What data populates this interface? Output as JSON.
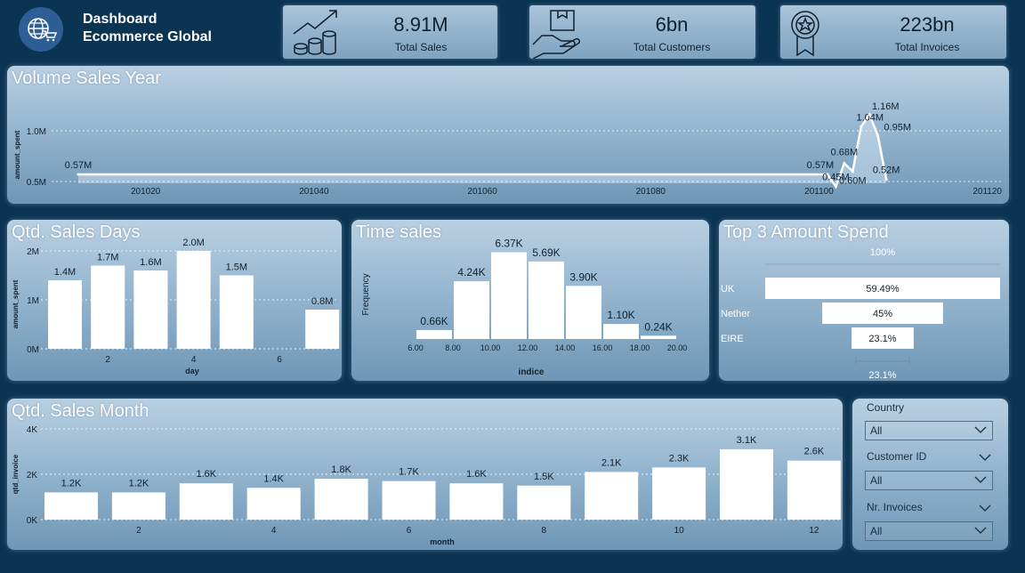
{
  "header": {
    "title_line1": "Dashboard",
    "title_line2": "Ecommerce Global",
    "logo_icon": "globe-cart-icon"
  },
  "kpis": [
    {
      "value": "8.91M",
      "label": "Total Sales",
      "icon": "coins-growth-icon"
    },
    {
      "value": "6bn",
      "label": "Total Customers",
      "icon": "hand-box-icon"
    },
    {
      "value": "223bn",
      "label": "Total Invoices",
      "icon": "award-badge-icon"
    }
  ],
  "colors": {
    "background": "#0b3352",
    "bar": "#ffffff",
    "panel_top": "#b9d0e3",
    "panel_bottom": "#6f97b5"
  },
  "volume_year": {
    "title": "Volume Sales Year",
    "chart_data": {
      "type": "area",
      "ylabel": "amount_spent",
      "y_ticks": [
        "0.5M",
        "1.0M"
      ],
      "x_ticks": [
        "201020",
        "201040",
        "201060",
        "201080",
        "201100",
        "201120"
      ],
      "points": [
        {
          "x": 201012,
          "y": 0.57,
          "label": "0.57M"
        },
        {
          "x": 201101,
          "y": 0.57,
          "label": "0.57M"
        },
        {
          "x": 201102,
          "y": 0.45,
          "label": "0.45M"
        },
        {
          "x": 201103,
          "y": 0.68,
          "label": "0.68M"
        },
        {
          "x": 201104,
          "y": 0.6,
          "label": "0.60M"
        },
        {
          "x": 201105,
          "y": 1.04,
          "label": "1.04M"
        },
        {
          "x": 201106,
          "y": 1.16,
          "label": "1.16M"
        },
        {
          "x": 201107,
          "y": 0.95,
          "label": "0.95M"
        },
        {
          "x": 201108,
          "y": 0.52,
          "label": "0.52M"
        }
      ]
    }
  },
  "sales_days": {
    "title": "Qtd. Sales Days",
    "chart_data": {
      "type": "bar",
      "xlabel": "day",
      "ylabel": "amount_spent",
      "y_ticks": [
        "0M",
        "1M",
        "2M"
      ],
      "x_ticks": [
        "2",
        "4",
        "6"
      ],
      "categories": [
        1,
        2,
        3,
        4,
        5,
        7
      ],
      "values": [
        1.4,
        1.7,
        1.6,
        2.0,
        1.5,
        0.8
      ],
      "labels": [
        "1.4M",
        "1.7M",
        "1.6M",
        "2.0M",
        "1.5M",
        "0.8M"
      ]
    }
  },
  "time_sales": {
    "title": "Time sales",
    "chart_data": {
      "type": "bar",
      "xlabel": "indice",
      "ylabel": "Frequency",
      "x_ticks": [
        "6.00",
        "8.00",
        "10.00",
        "12.00",
        "14.00",
        "16.00",
        "18.00",
        "20.00"
      ],
      "bins": [
        [
          6,
          8
        ],
        [
          8,
          10
        ],
        [
          10,
          12
        ],
        [
          12,
          14
        ],
        [
          14,
          16
        ],
        [
          16,
          18
        ],
        [
          18,
          20
        ]
      ],
      "values": [
        0.66,
        4.24,
        6.37,
        5.69,
        3.9,
        1.1,
        0.24
      ],
      "labels": [
        "0.66K",
        "4.24K",
        "6.37K",
        "5.69K",
        "3.90K",
        "1.10K",
        "0.24K"
      ]
    }
  },
  "top3": {
    "title": "Top 3 Amount Spend",
    "top_label": "100%",
    "bottom_label": "23.1%",
    "chart_data": {
      "type": "bar",
      "categories": [
        "UK",
        "Nether",
        "EIRE"
      ],
      "values": [
        59.49,
        45,
        23.1
      ],
      "labels": [
        "59.49%",
        "45%",
        "23.1%"
      ]
    }
  },
  "sales_month": {
    "title": "Qtd. Sales Month",
    "chart_data": {
      "type": "bar",
      "xlabel": "month",
      "ylabel": "qtd_invoice",
      "y_ticks": [
        "0K",
        "2K",
        "4K"
      ],
      "x_ticks": [
        "2",
        "4",
        "6",
        "8",
        "10",
        "12"
      ],
      "categories": [
        1,
        2,
        3,
        4,
        5,
        6,
        7,
        8,
        9,
        10,
        11,
        12
      ],
      "values": [
        1.2,
        1.2,
        1.6,
        1.4,
        1.8,
        1.7,
        1.6,
        1.5,
        2.1,
        2.3,
        3.1,
        2.6
      ],
      "labels": [
        "1.2K",
        "1.2K",
        "1.6K",
        "1.4K",
        "1.8K",
        "1.7K",
        "1.6K",
        "1.5K",
        "2.1K",
        "2.3K",
        "3.1K",
        "2.6K"
      ]
    }
  },
  "slicers": [
    {
      "label": "Country",
      "value": "All"
    },
    {
      "label": "Customer ID",
      "value": "All"
    },
    {
      "label": "Nr. Invoices",
      "value": "All"
    }
  ]
}
